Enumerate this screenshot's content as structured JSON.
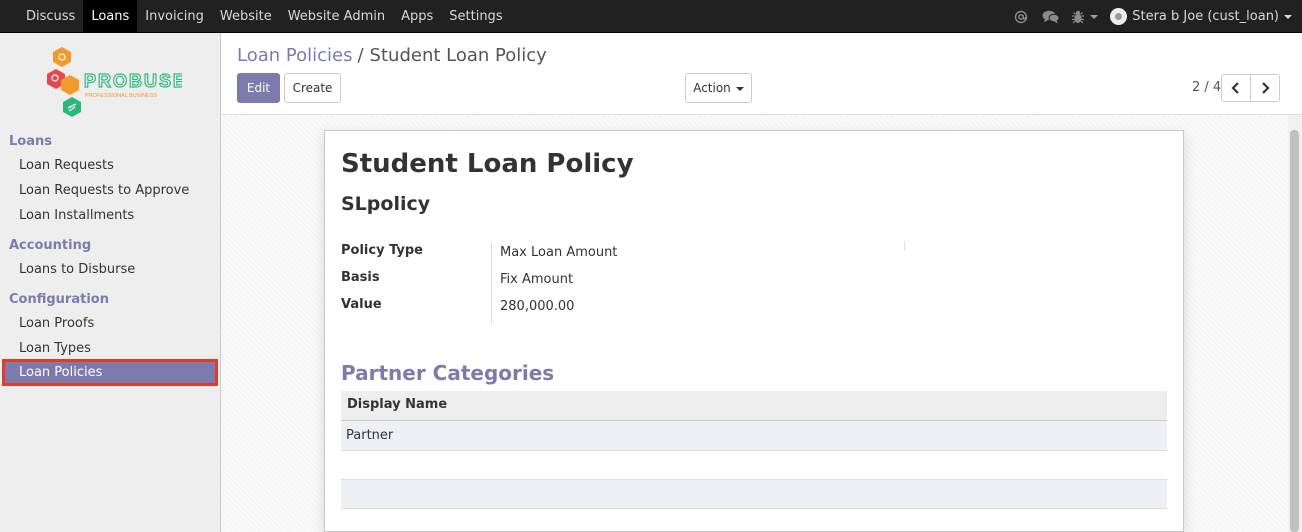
{
  "topbar": {
    "menu": [
      "Discuss",
      "Loans",
      "Invoicing",
      "Website",
      "Website Admin",
      "Apps",
      "Settings"
    ],
    "active_menu": "Loans",
    "user": "Stera b Joe (cust_loan)"
  },
  "logo": {
    "text": "PROBUSE",
    "tagline": "PROFESSIONAL BUSINESS"
  },
  "sidebar": {
    "sections": [
      {
        "title": "Loans",
        "items": [
          "Loan Requests",
          "Loan Requests to Approve",
          "Loan Installments"
        ]
      },
      {
        "title": "Accounting",
        "items": [
          "Loans to Disburse"
        ]
      },
      {
        "title": "Configuration",
        "items": [
          "Loan Proofs",
          "Loan Types",
          "Loan Policies"
        ]
      }
    ],
    "active_item": "Loan Policies"
  },
  "breadcrumb": {
    "parent": "Loan Policies",
    "separator": "/",
    "current": "Student Loan Policy"
  },
  "buttons": {
    "edit": "Edit",
    "create": "Create",
    "action": "Action"
  },
  "pager": {
    "text": "2 / 4"
  },
  "record": {
    "title": "Student Loan Policy",
    "code": "SLpolicy",
    "fields": [
      {
        "label": "Policy Type",
        "value": "Max Loan Amount"
      },
      {
        "label": "Basis",
        "value": "Fix Amount"
      },
      {
        "label": "Value",
        "value": "280,000.00"
      }
    ]
  },
  "partner_categories": {
    "title": "Partner Categories",
    "column": "Display Name",
    "rows": [
      "Partner"
    ]
  },
  "colors": {
    "accent": "#7c7bad",
    "highlight_border": "#e53a23",
    "navbar": "#212121"
  }
}
